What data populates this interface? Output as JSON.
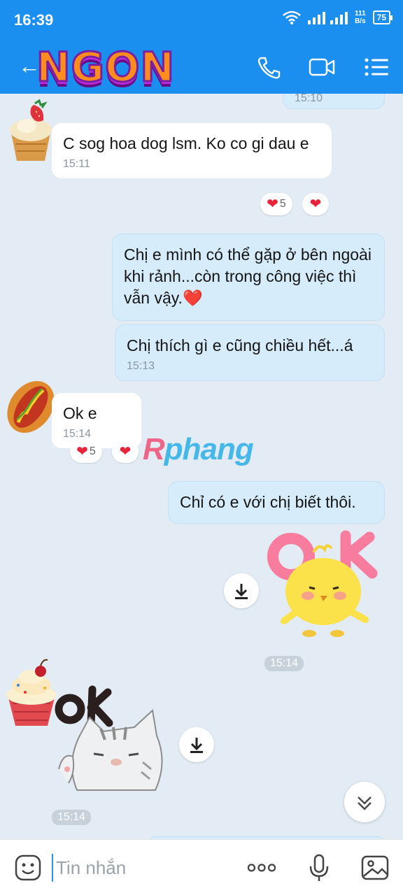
{
  "status": {
    "time": "16:39",
    "net_speed_value": "111",
    "net_speed_unit": "B/s",
    "battery": "75"
  },
  "header": {
    "logo_text": "NGON",
    "back_icon": "arrow-left-icon",
    "call_icon": "phone-icon",
    "video_icon": "video-icon",
    "menu_icon": "list-menu-icon"
  },
  "watermark": {
    "part1": "R",
    "part2": "phang"
  },
  "messages": [
    {
      "direction": "out",
      "text": "",
      "time": "15:10"
    },
    {
      "direction": "in",
      "avatar": "cupcake-strawberry-avatar",
      "text": "C sog hoa dog lsm. Ko co gi dau e",
      "time": "15:11",
      "reactions": {
        "count": "5",
        "mine": "heart"
      }
    },
    {
      "direction": "out",
      "text": "Chị e mình có thể gặp ở bên ngoài khi rảnh...còn trong công việc thì vẫn vậy.❤️",
      "time": ""
    },
    {
      "direction": "out",
      "text": "Chị thích gì e cũng chiều hết...á",
      "time": "15:13"
    },
    {
      "direction": "in",
      "avatar": "hotdog-avatar",
      "text": "Ok e",
      "time": "15:14",
      "reactions": {
        "count": "5",
        "mine": "heart"
      }
    },
    {
      "direction": "out",
      "text": "Chỉ có e với chị biết thôi.",
      "time": ""
    },
    {
      "direction": "out",
      "type": "sticker",
      "sticker_text": "OK",
      "time": "15:14"
    },
    {
      "direction": "in",
      "avatar": "cupcake-avatar",
      "type": "sticker",
      "sticker_text": "OK",
      "time": "15:14"
    }
  ],
  "input": {
    "placeholder": "Tin nhắn",
    "emoji_icon": "emoji-icon",
    "more_icon": "more-dots-icon",
    "mic_icon": "microphone-icon",
    "image_icon": "image-icon"
  },
  "colors": {
    "header_bg": "#1a8ff0",
    "chat_bg": "#e3ecf4",
    "out_bubble": "#d6ecfb",
    "in_bubble": "#ffffff",
    "heart": "#e8243c"
  }
}
